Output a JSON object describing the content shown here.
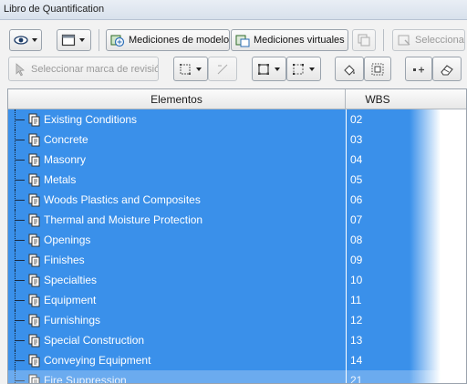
{
  "window": {
    "title": "Libro de Quantification"
  },
  "toolbar": {
    "view_button": {
      "icon": "eye-icon"
    },
    "display_button": {
      "icon": "window-icon"
    },
    "model_measurements": {
      "label": "Mediciones de modelo",
      "icon": "model-measure-icon"
    },
    "virtual_measurements": {
      "label": "Mediciones virtuales",
      "icon": "virtual-measure-icon"
    },
    "copy_button": {
      "icon": "copy-icon"
    },
    "select_button": {
      "label": "Seleccionar",
      "icon": "select-icon"
    },
    "select_revision_mark": {
      "label": "Seleccionar marca de revisión",
      "icon": "pointer-icon"
    },
    "draw_area": {
      "icon": "area-icon"
    },
    "draw_line": {
      "icon": "line-icon"
    },
    "area_tool": {
      "icon": "area-tool-icon"
    },
    "polyline_tool": {
      "icon": "polyline-icon"
    },
    "bucket_tool": {
      "icon": "bucket-icon"
    },
    "box_select": {
      "icon": "box-select-icon"
    },
    "measure_tool": {
      "icon": "measure-icon"
    },
    "eraser_tool": {
      "icon": "eraser-icon"
    }
  },
  "table": {
    "columns": [
      "Elementos",
      "WBS"
    ],
    "rows": [
      {
        "name": "Existing Conditions",
        "wbs": "02"
      },
      {
        "name": "Concrete",
        "wbs": "03"
      },
      {
        "name": "Masonry",
        "wbs": "04"
      },
      {
        "name": "Metals",
        "wbs": "05"
      },
      {
        "name": "Woods Plastics and Composites",
        "wbs": "06"
      },
      {
        "name": "Thermal and Moisture Protection",
        "wbs": "07"
      },
      {
        "name": "Openings",
        "wbs": "08"
      },
      {
        "name": "Finishes",
        "wbs": "09"
      },
      {
        "name": "Specialties",
        "wbs": "10"
      },
      {
        "name": "Equipment",
        "wbs": "11"
      },
      {
        "name": "Furnishings",
        "wbs": "12"
      },
      {
        "name": "Special Construction",
        "wbs": "13"
      },
      {
        "name": "Conveying Equipment",
        "wbs": "14"
      },
      {
        "name": "Fire Suppression",
        "wbs": "21"
      }
    ]
  },
  "colors": {
    "selection": "#3a90ea",
    "text_selected": "#ffffff"
  }
}
